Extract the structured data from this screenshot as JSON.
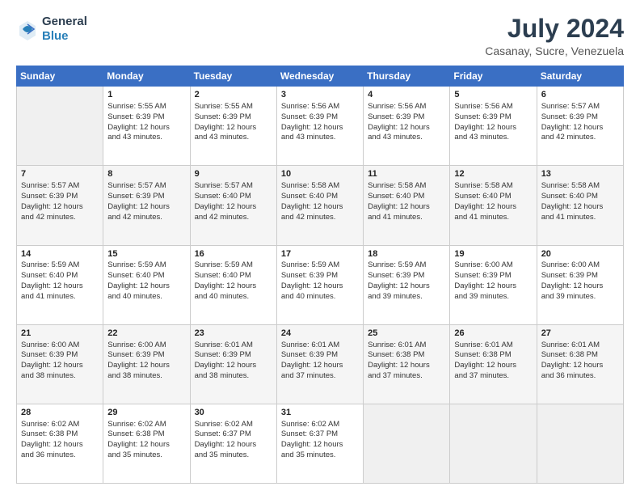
{
  "logo": {
    "line1": "General",
    "line2": "Blue"
  },
  "title": "July 2024",
  "subtitle": "Casanay, Sucre, Venezuela",
  "weekdays": [
    "Sunday",
    "Monday",
    "Tuesday",
    "Wednesday",
    "Thursday",
    "Friday",
    "Saturday"
  ],
  "weeks": [
    [
      {
        "day": "",
        "empty": true
      },
      {
        "day": "1",
        "rise": "Sunrise: 5:55 AM",
        "set": "Sunset: 6:39 PM",
        "daylight": "Daylight: 12 hours and 43 minutes."
      },
      {
        "day": "2",
        "rise": "Sunrise: 5:55 AM",
        "set": "Sunset: 6:39 PM",
        "daylight": "Daylight: 12 hours and 43 minutes."
      },
      {
        "day": "3",
        "rise": "Sunrise: 5:56 AM",
        "set": "Sunset: 6:39 PM",
        "daylight": "Daylight: 12 hours and 43 minutes."
      },
      {
        "day": "4",
        "rise": "Sunrise: 5:56 AM",
        "set": "Sunset: 6:39 PM",
        "daylight": "Daylight: 12 hours and 43 minutes."
      },
      {
        "day": "5",
        "rise": "Sunrise: 5:56 AM",
        "set": "Sunset: 6:39 PM",
        "daylight": "Daylight: 12 hours and 43 minutes."
      },
      {
        "day": "6",
        "rise": "Sunrise: 5:57 AM",
        "set": "Sunset: 6:39 PM",
        "daylight": "Daylight: 12 hours and 42 minutes."
      }
    ],
    [
      {
        "day": "7",
        "rise": "Sunrise: 5:57 AM",
        "set": "Sunset: 6:39 PM",
        "daylight": "Daylight: 12 hours and 42 minutes."
      },
      {
        "day": "8",
        "rise": "Sunrise: 5:57 AM",
        "set": "Sunset: 6:39 PM",
        "daylight": "Daylight: 12 hours and 42 minutes."
      },
      {
        "day": "9",
        "rise": "Sunrise: 5:57 AM",
        "set": "Sunset: 6:40 PM",
        "daylight": "Daylight: 12 hours and 42 minutes."
      },
      {
        "day": "10",
        "rise": "Sunrise: 5:58 AM",
        "set": "Sunset: 6:40 PM",
        "daylight": "Daylight: 12 hours and 42 minutes."
      },
      {
        "day": "11",
        "rise": "Sunrise: 5:58 AM",
        "set": "Sunset: 6:40 PM",
        "daylight": "Daylight: 12 hours and 41 minutes."
      },
      {
        "day": "12",
        "rise": "Sunrise: 5:58 AM",
        "set": "Sunset: 6:40 PM",
        "daylight": "Daylight: 12 hours and 41 minutes."
      },
      {
        "day": "13",
        "rise": "Sunrise: 5:58 AM",
        "set": "Sunset: 6:40 PM",
        "daylight": "Daylight: 12 hours and 41 minutes."
      }
    ],
    [
      {
        "day": "14",
        "rise": "Sunrise: 5:59 AM",
        "set": "Sunset: 6:40 PM",
        "daylight": "Daylight: 12 hours and 41 minutes."
      },
      {
        "day": "15",
        "rise": "Sunrise: 5:59 AM",
        "set": "Sunset: 6:40 PM",
        "daylight": "Daylight: 12 hours and 40 minutes."
      },
      {
        "day": "16",
        "rise": "Sunrise: 5:59 AM",
        "set": "Sunset: 6:40 PM",
        "daylight": "Daylight: 12 hours and 40 minutes."
      },
      {
        "day": "17",
        "rise": "Sunrise: 5:59 AM",
        "set": "Sunset: 6:39 PM",
        "daylight": "Daylight: 12 hours and 40 minutes."
      },
      {
        "day": "18",
        "rise": "Sunrise: 5:59 AM",
        "set": "Sunset: 6:39 PM",
        "daylight": "Daylight: 12 hours and 39 minutes."
      },
      {
        "day": "19",
        "rise": "Sunrise: 6:00 AM",
        "set": "Sunset: 6:39 PM",
        "daylight": "Daylight: 12 hours and 39 minutes."
      },
      {
        "day": "20",
        "rise": "Sunrise: 6:00 AM",
        "set": "Sunset: 6:39 PM",
        "daylight": "Daylight: 12 hours and 39 minutes."
      }
    ],
    [
      {
        "day": "21",
        "rise": "Sunrise: 6:00 AM",
        "set": "Sunset: 6:39 PM",
        "daylight": "Daylight: 12 hours and 38 minutes."
      },
      {
        "day": "22",
        "rise": "Sunrise: 6:00 AM",
        "set": "Sunset: 6:39 PM",
        "daylight": "Daylight: 12 hours and 38 minutes."
      },
      {
        "day": "23",
        "rise": "Sunrise: 6:01 AM",
        "set": "Sunset: 6:39 PM",
        "daylight": "Daylight: 12 hours and 38 minutes."
      },
      {
        "day": "24",
        "rise": "Sunrise: 6:01 AM",
        "set": "Sunset: 6:39 PM",
        "daylight": "Daylight: 12 hours and 37 minutes."
      },
      {
        "day": "25",
        "rise": "Sunrise: 6:01 AM",
        "set": "Sunset: 6:38 PM",
        "daylight": "Daylight: 12 hours and 37 minutes."
      },
      {
        "day": "26",
        "rise": "Sunrise: 6:01 AM",
        "set": "Sunset: 6:38 PM",
        "daylight": "Daylight: 12 hours and 37 minutes."
      },
      {
        "day": "27",
        "rise": "Sunrise: 6:01 AM",
        "set": "Sunset: 6:38 PM",
        "daylight": "Daylight: 12 hours and 36 minutes."
      }
    ],
    [
      {
        "day": "28",
        "rise": "Sunrise: 6:02 AM",
        "set": "Sunset: 6:38 PM",
        "daylight": "Daylight: 12 hours and 36 minutes."
      },
      {
        "day": "29",
        "rise": "Sunrise: 6:02 AM",
        "set": "Sunset: 6:38 PM",
        "daylight": "Daylight: 12 hours and 35 minutes."
      },
      {
        "day": "30",
        "rise": "Sunrise: 6:02 AM",
        "set": "Sunset: 6:37 PM",
        "daylight": "Daylight: 12 hours and 35 minutes."
      },
      {
        "day": "31",
        "rise": "Sunrise: 6:02 AM",
        "set": "Sunset: 6:37 PM",
        "daylight": "Daylight: 12 hours and 35 minutes."
      },
      {
        "day": "",
        "empty": true
      },
      {
        "day": "",
        "empty": true
      },
      {
        "day": "",
        "empty": true
      }
    ]
  ]
}
